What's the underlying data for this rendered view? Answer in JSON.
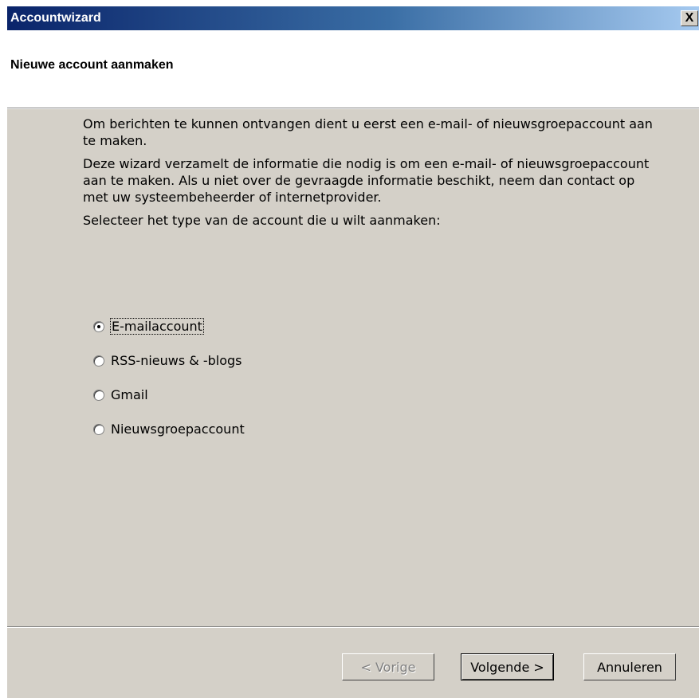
{
  "window": {
    "title": "Accountwizard",
    "close_label": "X"
  },
  "header": {
    "title": "Nieuwe account aanmaken"
  },
  "content": {
    "paragraphs": [
      "Om berichten te kunnen ontvangen dient u eerst een e-mail- of nieuwsgroepaccount aan te maken.",
      "Deze wizard verzamelt de informatie die nodig is om een e-mail- of nieuwsgroepaccount aan te maken. Als u niet over de gevraagde informatie beschikt, neem dan contact op met uw systeembeheerder of internetprovider.",
      "Selecteer het type van de account die u wilt aanmaken:"
    ],
    "options": [
      {
        "label": "E-mailaccount",
        "selected": true
      },
      {
        "label": "RSS-nieuws & -blogs",
        "selected": false
      },
      {
        "label": "Gmail",
        "selected": false
      },
      {
        "label": "Nieuwsgroepaccount",
        "selected": false
      }
    ]
  },
  "buttons": {
    "prev_label": "< Vorige",
    "next_label": "Volgende >",
    "cancel_label": "Annuleren"
  },
  "colors": {
    "titlebar_start": "#0a246a",
    "titlebar_end": "#a6caf0",
    "dialog_face": "#d4d0c8"
  }
}
